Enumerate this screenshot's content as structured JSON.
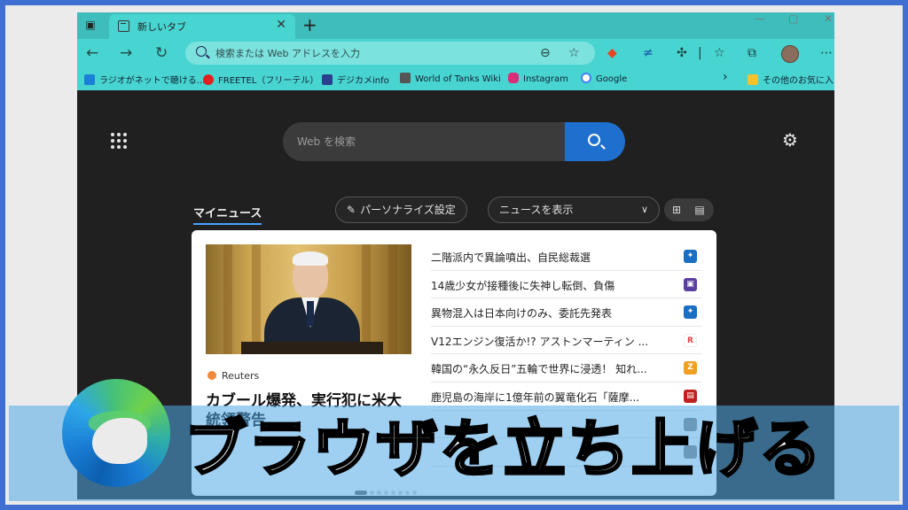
{
  "tab": {
    "title": "新しいタブ",
    "close": "✕",
    "new_tab": "+"
  },
  "window_controls": {
    "minimize": "—",
    "maximize": "▢",
    "close": "✕"
  },
  "toolbar": {
    "back": "←",
    "forward": "→",
    "refresh": "↻"
  },
  "address_bar": {
    "placeholder": "検索または Web アドレスを入力"
  },
  "bookmarks": [
    {
      "label": "ラジオがネットで聴ける...",
      "color": "#1a7fd6"
    },
    {
      "label": "FREETEL（フリーテル）",
      "color": "#e02020"
    },
    {
      "label": "デジカメinfo",
      "color": "#2a3f8f"
    },
    {
      "label": "World of Tanks Wiki",
      "color": "#555555"
    },
    {
      "label": "Instagram",
      "color": "#d6307a"
    },
    {
      "label": "Google",
      "color": "#4285f4"
    }
  ],
  "bookmarks_more": "›",
  "other_favorites": "その他のお気に入り",
  "search": {
    "placeholder": "Web を検索"
  },
  "feed": {
    "tab_label": "マイニュース",
    "personalize": "パーソナライズ設定",
    "show_news": "ニュースを表示",
    "headline_source": "Reuters",
    "headline": "カブール爆発、実行犯に米大統領警告",
    "items": [
      {
        "title": "二階派内で異論噴出、自民総裁選",
        "logo_color": "#1a6fc2"
      },
      {
        "title": "14歳少女が接種後に失神し転倒、負傷",
        "logo_color": "#5b3fa0"
      },
      {
        "title": "異物混入は日本向けのみ、委託先発表",
        "logo_color": "#1a6fc2"
      },
      {
        "title": "V12エンジン復活か!? アストンマーティン ...",
        "logo_color": "#e04040"
      },
      {
        "title": "韓国の“永久反日”五輪で世界に浸透！ 知れ...",
        "logo_color": "#f0a020"
      },
      {
        "title": "鹿児島の海岸に1億年前の翼竜化石「薩摩...",
        "logo_color": "#c02020"
      },
      {
        "title": "",
        "logo_color": "#888888"
      },
      {
        "title": "",
        "logo_color": "#888888"
      }
    ]
  },
  "overlay_title": "ブラウザを立ち上げる"
}
